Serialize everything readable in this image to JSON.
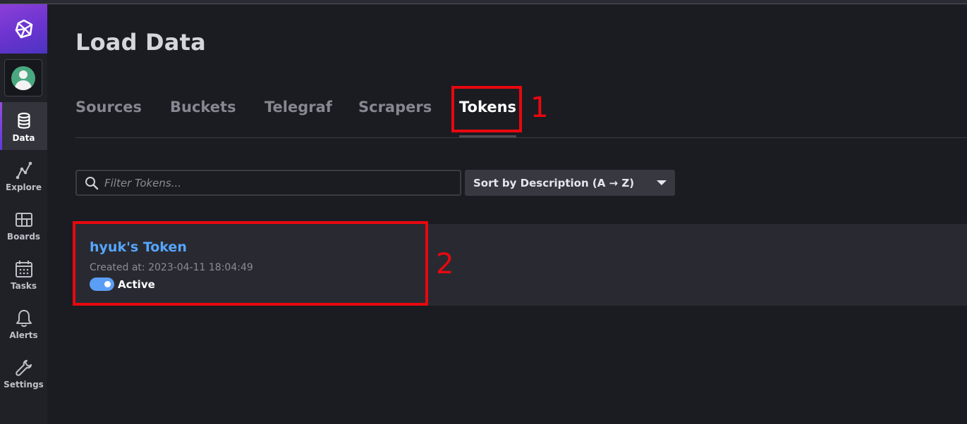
{
  "sidebar": {
    "items": [
      {
        "label": "Data",
        "icon": "database-icon",
        "active": true
      },
      {
        "label": "Explore",
        "icon": "graph-icon",
        "active": false
      },
      {
        "label": "Boards",
        "icon": "dashboard-grid-icon",
        "active": false
      },
      {
        "label": "Tasks",
        "icon": "calendar-icon",
        "active": false
      },
      {
        "label": "Alerts",
        "icon": "bell-icon",
        "active": false
      },
      {
        "label": "Settings",
        "icon": "wrench-icon",
        "active": false
      }
    ]
  },
  "header": {
    "title": "Load Data"
  },
  "tabs": [
    {
      "label": "Sources"
    },
    {
      "label": "Buckets"
    },
    {
      "label": "Telegraf"
    },
    {
      "label": "Scrapers"
    },
    {
      "label": "Tokens",
      "active": true
    }
  ],
  "annotations": {
    "one": "1",
    "two": "2"
  },
  "filter": {
    "placeholder": "Filter Tokens...",
    "value": ""
  },
  "sort": {
    "label": "Sort by Description (A → Z)"
  },
  "tokens": [
    {
      "name": "hyuk's Token",
      "created": "Created at: 2023-04-11 18:04:49",
      "status": "Active",
      "enabled": true
    }
  ],
  "colors": {
    "background": "#1b1c21",
    "sidebar": "#202027",
    "brand_gradient_start": "#8b40d8",
    "brand_gradient_end": "#4b34c0",
    "link": "#56a6ff",
    "toggle_on": "#5b9ef5",
    "annotation_red": "#e8080f"
  }
}
